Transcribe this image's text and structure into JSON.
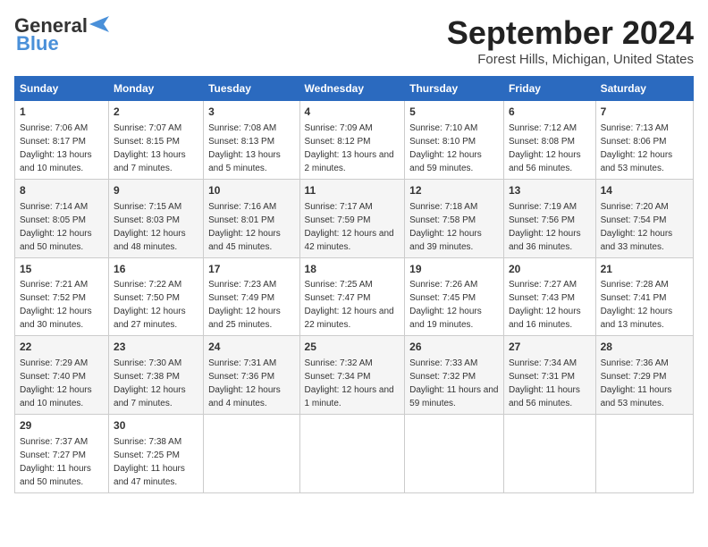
{
  "logo": {
    "line1": "General",
    "line2": "Blue"
  },
  "title": "September 2024",
  "subtitle": "Forest Hills, Michigan, United States",
  "headers": [
    "Sunday",
    "Monday",
    "Tuesday",
    "Wednesday",
    "Thursday",
    "Friday",
    "Saturday"
  ],
  "weeks": [
    [
      {
        "day": "1",
        "info": "Sunrise: 7:06 AM\nSunset: 8:17 PM\nDaylight: 13 hours and 10 minutes."
      },
      {
        "day": "2",
        "info": "Sunrise: 7:07 AM\nSunset: 8:15 PM\nDaylight: 13 hours and 7 minutes."
      },
      {
        "day": "3",
        "info": "Sunrise: 7:08 AM\nSunset: 8:13 PM\nDaylight: 13 hours and 5 minutes."
      },
      {
        "day": "4",
        "info": "Sunrise: 7:09 AM\nSunset: 8:12 PM\nDaylight: 13 hours and 2 minutes."
      },
      {
        "day": "5",
        "info": "Sunrise: 7:10 AM\nSunset: 8:10 PM\nDaylight: 12 hours and 59 minutes."
      },
      {
        "day": "6",
        "info": "Sunrise: 7:12 AM\nSunset: 8:08 PM\nDaylight: 12 hours and 56 minutes."
      },
      {
        "day": "7",
        "info": "Sunrise: 7:13 AM\nSunset: 8:06 PM\nDaylight: 12 hours and 53 minutes."
      }
    ],
    [
      {
        "day": "8",
        "info": "Sunrise: 7:14 AM\nSunset: 8:05 PM\nDaylight: 12 hours and 50 minutes."
      },
      {
        "day": "9",
        "info": "Sunrise: 7:15 AM\nSunset: 8:03 PM\nDaylight: 12 hours and 48 minutes."
      },
      {
        "day": "10",
        "info": "Sunrise: 7:16 AM\nSunset: 8:01 PM\nDaylight: 12 hours and 45 minutes."
      },
      {
        "day": "11",
        "info": "Sunrise: 7:17 AM\nSunset: 7:59 PM\nDaylight: 12 hours and 42 minutes."
      },
      {
        "day": "12",
        "info": "Sunrise: 7:18 AM\nSunset: 7:58 PM\nDaylight: 12 hours and 39 minutes."
      },
      {
        "day": "13",
        "info": "Sunrise: 7:19 AM\nSunset: 7:56 PM\nDaylight: 12 hours and 36 minutes."
      },
      {
        "day": "14",
        "info": "Sunrise: 7:20 AM\nSunset: 7:54 PM\nDaylight: 12 hours and 33 minutes."
      }
    ],
    [
      {
        "day": "15",
        "info": "Sunrise: 7:21 AM\nSunset: 7:52 PM\nDaylight: 12 hours and 30 minutes."
      },
      {
        "day": "16",
        "info": "Sunrise: 7:22 AM\nSunset: 7:50 PM\nDaylight: 12 hours and 27 minutes."
      },
      {
        "day": "17",
        "info": "Sunrise: 7:23 AM\nSunset: 7:49 PM\nDaylight: 12 hours and 25 minutes."
      },
      {
        "day": "18",
        "info": "Sunrise: 7:25 AM\nSunset: 7:47 PM\nDaylight: 12 hours and 22 minutes."
      },
      {
        "day": "19",
        "info": "Sunrise: 7:26 AM\nSunset: 7:45 PM\nDaylight: 12 hours and 19 minutes."
      },
      {
        "day": "20",
        "info": "Sunrise: 7:27 AM\nSunset: 7:43 PM\nDaylight: 12 hours and 16 minutes."
      },
      {
        "day": "21",
        "info": "Sunrise: 7:28 AM\nSunset: 7:41 PM\nDaylight: 12 hours and 13 minutes."
      }
    ],
    [
      {
        "day": "22",
        "info": "Sunrise: 7:29 AM\nSunset: 7:40 PM\nDaylight: 12 hours and 10 minutes."
      },
      {
        "day": "23",
        "info": "Sunrise: 7:30 AM\nSunset: 7:38 PM\nDaylight: 12 hours and 7 minutes."
      },
      {
        "day": "24",
        "info": "Sunrise: 7:31 AM\nSunset: 7:36 PM\nDaylight: 12 hours and 4 minutes."
      },
      {
        "day": "25",
        "info": "Sunrise: 7:32 AM\nSunset: 7:34 PM\nDaylight: 12 hours and 1 minute."
      },
      {
        "day": "26",
        "info": "Sunrise: 7:33 AM\nSunset: 7:32 PM\nDaylight: 11 hours and 59 minutes."
      },
      {
        "day": "27",
        "info": "Sunrise: 7:34 AM\nSunset: 7:31 PM\nDaylight: 11 hours and 56 minutes."
      },
      {
        "day": "28",
        "info": "Sunrise: 7:36 AM\nSunset: 7:29 PM\nDaylight: 11 hours and 53 minutes."
      }
    ],
    [
      {
        "day": "29",
        "info": "Sunrise: 7:37 AM\nSunset: 7:27 PM\nDaylight: 11 hours and 50 minutes."
      },
      {
        "day": "30",
        "info": "Sunrise: 7:38 AM\nSunset: 7:25 PM\nDaylight: 11 hours and 47 minutes."
      },
      {
        "day": "",
        "info": ""
      },
      {
        "day": "",
        "info": ""
      },
      {
        "day": "",
        "info": ""
      },
      {
        "day": "",
        "info": ""
      },
      {
        "day": "",
        "info": ""
      }
    ]
  ]
}
